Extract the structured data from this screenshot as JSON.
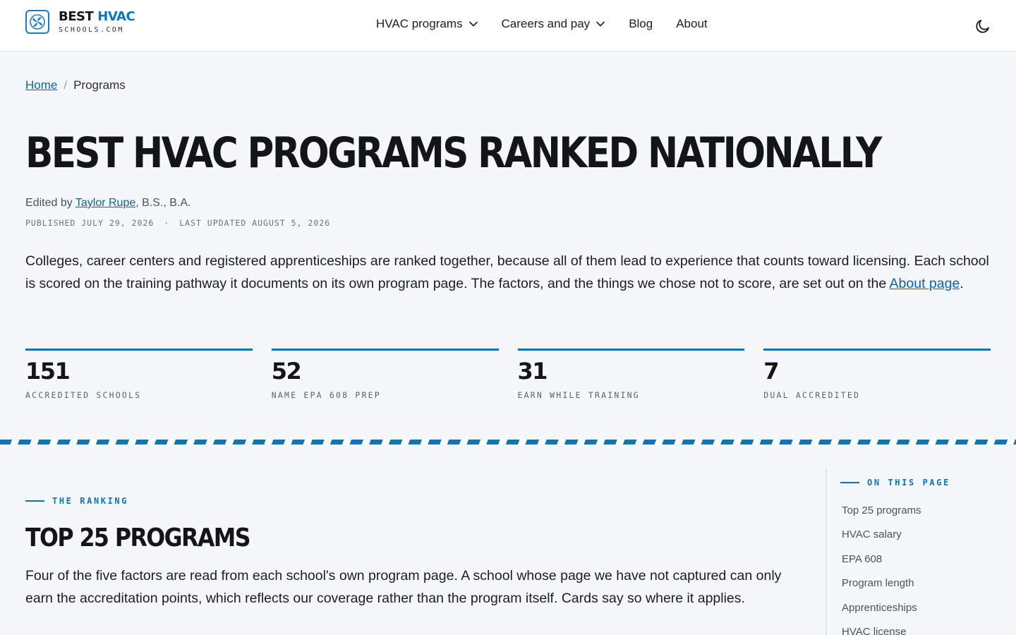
{
  "header": {
    "logo": {
      "line1_a": "BEST",
      "line1_b": "HVAC",
      "line2": "SCHOOLS.COM"
    },
    "nav": [
      {
        "label": "HVAC programs",
        "dropdown": true
      },
      {
        "label": "Careers and pay",
        "dropdown": true
      },
      {
        "label": "Blog",
        "dropdown": false
      },
      {
        "label": "About",
        "dropdown": false
      }
    ],
    "theme_toggle_icon": "moon-icon"
  },
  "breadcrumb": {
    "home": "Home",
    "separator": "/",
    "current": "Programs"
  },
  "page_title": "BEST HVAC PROGRAMS RANKED NATIONALLY",
  "byline": {
    "prefix": "Edited by ",
    "author": "Taylor Rupe",
    "credentials": ", B.S., B.A."
  },
  "dates": {
    "published": "PUBLISHED JULY 29, 2026",
    "separator": "·",
    "updated": "LAST UPDATED AUGUST 5, 2026"
  },
  "intro": {
    "text": "Colleges, career centers and registered apprenticeships are ranked together, because all of them lead to experience that counts toward licensing. Each school is scored on the training pathway it documents on its own program page. The factors, and the things we chose not to score, are set out on the ",
    "link": "About page",
    "suffix": "."
  },
  "stats": [
    {
      "value": "151",
      "label": "ACCREDITED SCHOOLS"
    },
    {
      "value": "52",
      "label": "NAME EPA 608 PREP"
    },
    {
      "value": "31",
      "label": "EARN WHILE TRAINING"
    },
    {
      "value": "7",
      "label": "DUAL ACCREDITED"
    }
  ],
  "section": {
    "kicker": "THE RANKING",
    "title": "TOP 25 PROGRAMS",
    "body": "Four of the five factors are read from each school's own program page. A school whose page we have not captured can only earn the accreditation points, which reflects our coverage rather than the program itself. Cards say so where it applies."
  },
  "toc": {
    "heading": "ON THIS PAGE",
    "items": [
      "Top 25 programs",
      "HVAC salary",
      "EPA 608",
      "Program length",
      "Apprenticeships",
      "HVAC license"
    ]
  },
  "colors": {
    "accent": "#0d74b8",
    "link": "#0b63a6",
    "background": "#f5f8fb",
    "text": "#15191d"
  }
}
